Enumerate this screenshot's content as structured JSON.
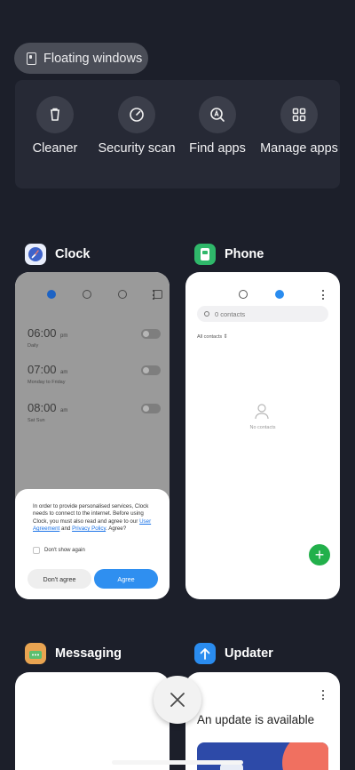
{
  "floating_windows": {
    "label": "Floating windows",
    "icon": "floating-window-icon"
  },
  "quick_actions": [
    {
      "label": "Cleaner",
      "icon": "trash-icon"
    },
    {
      "label": "Security scan",
      "icon": "gauge-icon"
    },
    {
      "label": "Find apps",
      "icon": "find-apps-icon"
    },
    {
      "label": "Manage apps",
      "icon": "grid-icon"
    }
  ],
  "apps": {
    "clock": {
      "name": "Clock",
      "icon": "clock-app-icon",
      "icon_color": "#3f63c9",
      "tabs": [
        "alarm-icon",
        "clock-icon",
        "stopwatch-icon",
        "timer-icon"
      ],
      "alarms": [
        {
          "time": "06:00",
          "ampm": "pm",
          "repeat": "Daily"
        },
        {
          "time": "07:00",
          "ampm": "am",
          "repeat": "Monday to Friday"
        },
        {
          "time": "08:00",
          "ampm": "am",
          "repeat": "Sat Sun"
        }
      ],
      "dialog": {
        "text_1": "In order to provide personalised services, Clock needs to connect to the internet. Before using Clock, you must also read and agree to our",
        "link_agreement": "User Agreement",
        "and": "and",
        "link_privacy": "Privacy Policy",
        "text_2": ". Agree?",
        "checkbox": "Don't show again",
        "decline": "Don't agree",
        "accept": "Agree"
      }
    },
    "phone": {
      "name": "Phone",
      "icon": "phone-app-icon",
      "icon_color": "#2fb86a",
      "search_placeholder": "0 contacts",
      "filter": "All contacts",
      "empty": "No contacts",
      "fab": "+"
    },
    "messaging": {
      "name": "Messaging",
      "icon": "messaging-app-icon",
      "icon_color": "#e9a451"
    },
    "updater": {
      "name": "Updater",
      "icon": "updater-app-icon",
      "icon_color": "#2a8cef",
      "title": "An update is available"
    }
  },
  "close_all": {
    "icon": "close-icon"
  },
  "colors": {
    "background": "#1c1f2a",
    "accent": "#2f8ff0"
  }
}
